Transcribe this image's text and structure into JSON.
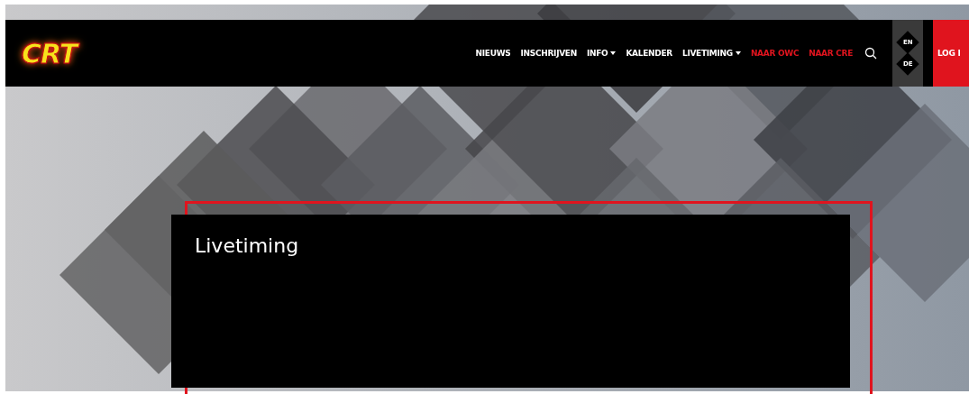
{
  "logo": {
    "text": "CRT"
  },
  "nav": [
    {
      "label": "NIEUWS",
      "kind": "link",
      "color": "#ffffff"
    },
    {
      "label": "INSCHRIJVEN",
      "kind": "link",
      "color": "#ffffff"
    },
    {
      "label": "INFO",
      "kind": "dropdown",
      "color": "#ffffff"
    },
    {
      "label": "KALENDER",
      "kind": "link",
      "color": "#ffffff"
    },
    {
      "label": "LIVETIMING",
      "kind": "dropdown",
      "color": "#ffffff"
    },
    {
      "label": "NAAR OWC",
      "kind": "link",
      "color": "#e0141e"
    },
    {
      "label": "NAAR CRE",
      "kind": "link",
      "color": "#e0141e"
    }
  ],
  "languages": [
    "EN",
    "DE"
  ],
  "login": "LOG I",
  "panel": {
    "title": "Livetiming"
  }
}
